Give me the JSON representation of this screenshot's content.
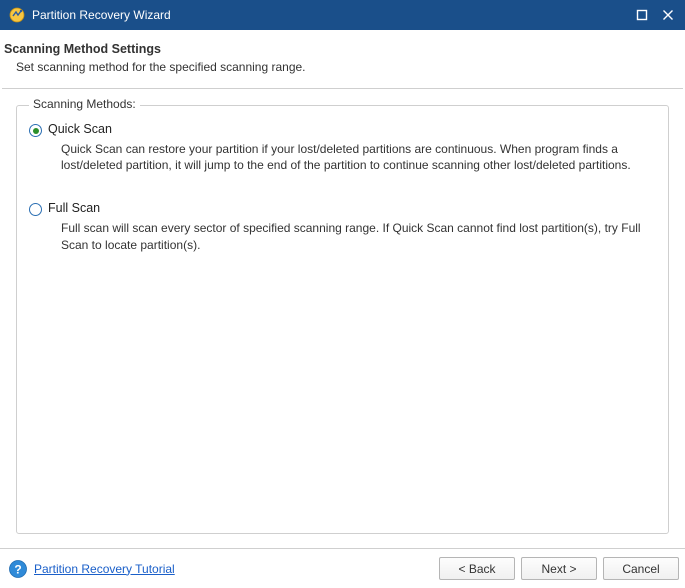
{
  "window": {
    "title": "Partition Recovery Wizard"
  },
  "header": {
    "title": "Scanning Method Settings",
    "subtitle": "Set scanning method for the specified scanning range."
  },
  "group": {
    "legend": "Scanning Methods:",
    "quick": {
      "label": "Quick Scan",
      "desc": "Quick Scan can restore your partition if your lost/deleted partitions are continuous. When program finds a lost/deleted partition, it will jump to the end of the partition to continue scanning other lost/deleted partitions.",
      "selected": true
    },
    "full": {
      "label": "Full Scan",
      "desc": "Full scan will scan every sector of specified scanning range. If Quick Scan cannot find lost partition(s), try Full Scan to locate partition(s).",
      "selected": false
    }
  },
  "footer": {
    "help_link": "Partition Recovery Tutorial",
    "buttons": {
      "back": "< Back",
      "next": "Next >",
      "cancel": "Cancel"
    }
  }
}
